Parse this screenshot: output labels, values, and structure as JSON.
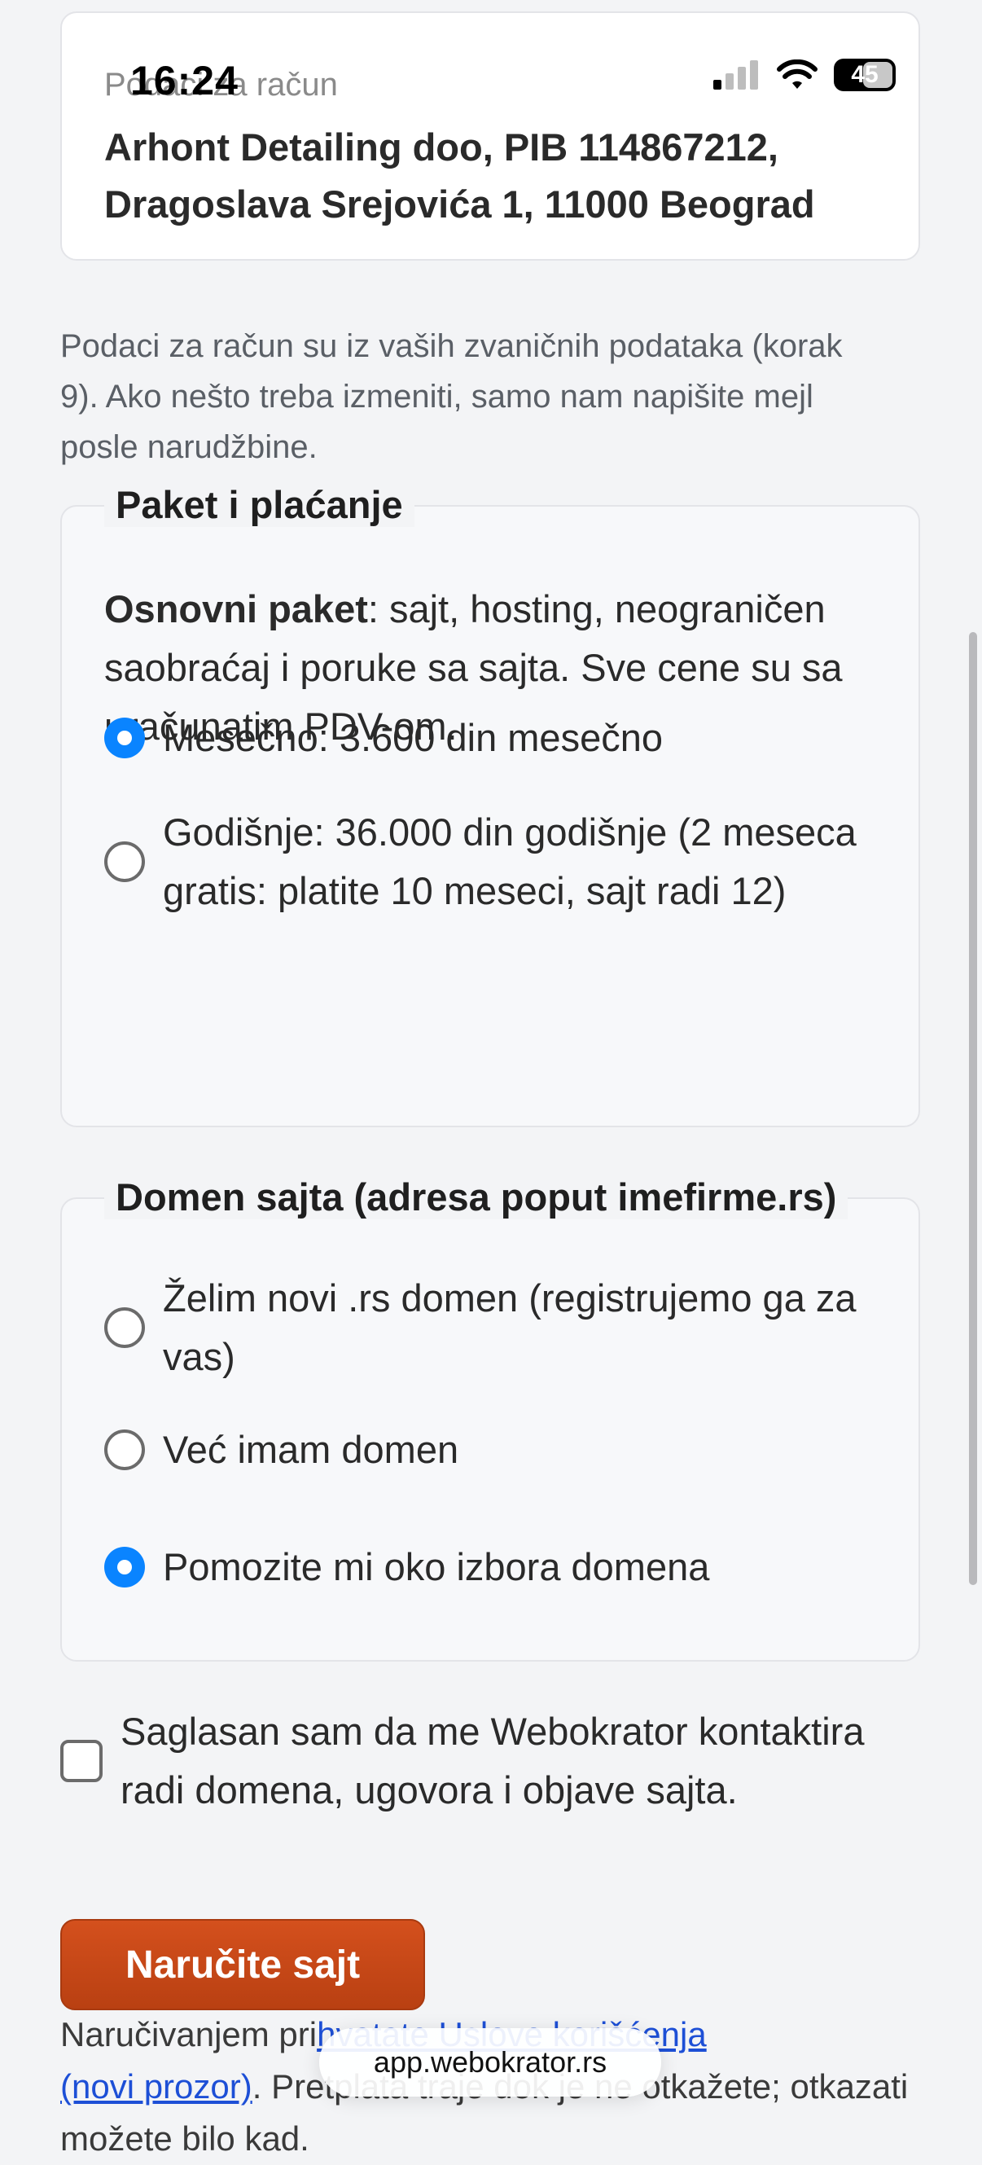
{
  "status_bar": {
    "time": "16:24",
    "battery": "45"
  },
  "billing": {
    "label": "Podaci za račun",
    "value": "Arhont Detailing doo, PIB 114867212, Dragoslava Srejovića 1, 11000 Beograd"
  },
  "billing_note": "Podaci za račun su iz vaših zvaničnih podataka (korak 9). Ako nešto treba izmeniti, samo nam napišite mejl posle narudžbine.",
  "package": {
    "legend": "Paket i plaćanje",
    "desc_bold": "Osnovni paket",
    "desc_rest": ": sajt, hosting, neograničen saobraćaj i poruke sa sajta. Sve cene su sa uračunatim PDV-om.",
    "options": [
      {
        "label": "Mesečno: 3.600 din mesečno",
        "checked": true
      },
      {
        "label": "Godišnje: 36.000 din godišnje (2 meseca gratis: platite 10 meseci, sajt radi 12)",
        "checked": false
      }
    ]
  },
  "domain": {
    "legend": "Domen sajta (adresa poput imefirme.rs)",
    "options": [
      {
        "label": "Želim novi .rs domen (registrujemo ga za vas)",
        "checked": false
      },
      {
        "label": "Već imam domen",
        "checked": false
      },
      {
        "label": "Pomozite mi oko izbora domena",
        "checked": true
      }
    ]
  },
  "consent": {
    "label": "Saglasan sam da me Webokrator kontaktira radi domena, ugovora i objave sajta.",
    "checked": false
  },
  "order_button": "Naručite sajt",
  "terms": {
    "before": "Naručivanjem pri",
    "link1": "hvatate Uslove korišćenja",
    "link2": "(novi prozor)",
    "after": ". Pretplata traje dok je ne otkažete; otkazati možete bilo kad."
  },
  "url_bar": "app.webokrator.rs",
  "colors": {
    "accent": "#0a84ff",
    "order_button": "#c8481a",
    "link": "#1d4fd6"
  }
}
